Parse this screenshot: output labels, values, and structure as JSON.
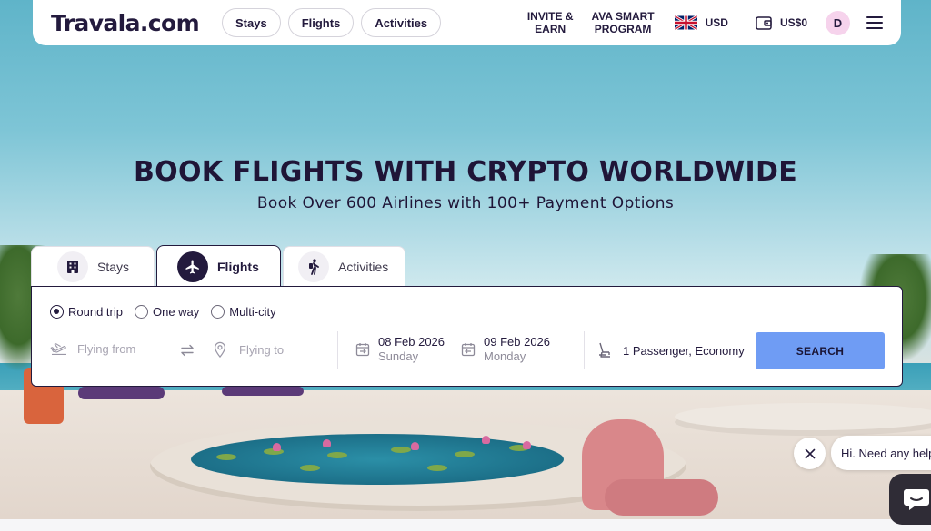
{
  "navbar": {
    "logo": "Travala.com",
    "pills": [
      "Stays",
      "Flights",
      "Activities"
    ],
    "invite_line1": "INVITE &",
    "invite_line2": "EARN",
    "ava_line1": "AVA SMART",
    "ava_line2": "PROGRAM",
    "currency": "USD",
    "wallet_balance": "US$0",
    "avatar_initial": "D"
  },
  "hero": {
    "title": "BOOK FLIGHTS WITH CRYPTO WORLDWIDE",
    "subtitle": "Book Over 600 Airlines with 100+ Payment Options"
  },
  "tabs": [
    {
      "label": "Stays",
      "icon": "building-icon",
      "active": false
    },
    {
      "label": "Flights",
      "icon": "airplane-icon",
      "active": true
    },
    {
      "label": "Activities",
      "icon": "hiker-icon",
      "active": false
    }
  ],
  "search": {
    "trip_types": [
      "Round trip",
      "One way",
      "Multi-city"
    ],
    "selected_trip_type": "Round trip",
    "from_placeholder": "Flying from",
    "to_placeholder": "Flying to",
    "depart_date": "08 Feb 2026",
    "depart_day": "Sunday",
    "return_date": "09 Feb 2026",
    "return_day": "Monday",
    "passengers": "1 Passenger, Economy",
    "search_label": "SEARCH"
  },
  "chat": {
    "greeting": "Hi. Need any help?"
  },
  "colors": {
    "brand_dark": "#231a3d",
    "search_button": "#6f9cf4",
    "avatar_bg": "#f6d3ec"
  }
}
